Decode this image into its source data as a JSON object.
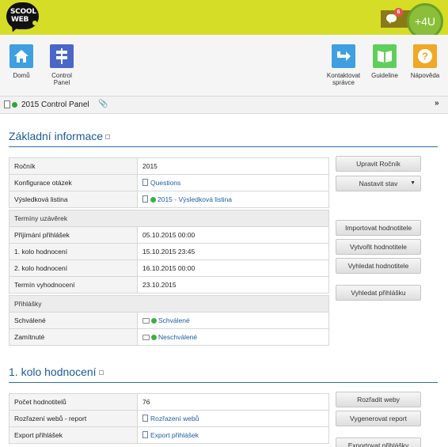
{
  "header": {
    "logo_line1": "SCOOL",
    "logo_line2": "WEB",
    "message_count": "6",
    "plus4u_label": "+4U"
  },
  "toolbar": {
    "items": [
      {
        "label": "Domů",
        "icon": "home-icon"
      },
      {
        "label": "Control Panel",
        "icon": "signpost-icon"
      },
      {
        "label": "Kontaktovat správce",
        "icon": "arrow-right-icon"
      },
      {
        "label": "Guideline",
        "icon": "book-icon"
      },
      {
        "label": "Nápověda",
        "icon": "question-icon"
      }
    ]
  },
  "breadcrumb": {
    "title": "2015 Control Panel"
  },
  "section1": {
    "title": "Základní informace",
    "rows": [
      {
        "key": "Ročník",
        "value": "2015"
      },
      {
        "key": "Konfigurace otázek",
        "value": "Questions"
      },
      {
        "key": "Výsledková listina",
        "value": "2015 - Výsledková listina"
      }
    ],
    "group_deadlines": "Termíny uzávěrek",
    "deadline_rows": [
      {
        "key": "Přijímání přihlášek",
        "value": "05.10.2015 00:00"
      },
      {
        "key": "1. kolo hodnocení",
        "value": "15.10.2015 23:45"
      },
      {
        "key": "2. kolo hodnocení",
        "value": "16.10.2015 00:00"
      },
      {
        "key": "Termín vyhodnocení",
        "value": "23.10.2015"
      }
    ],
    "group_applications": "Přihlášky",
    "application_rows": [
      {
        "key": "Schválené",
        "value": "Schválené"
      },
      {
        "key": "Zamítnuté",
        "value": "Neschválené"
      }
    ],
    "buttons": {
      "edit_year": "Upravit Ročník",
      "set_state": "Nastavit stav",
      "import_evaluators": "Importovat hodnotitele",
      "create_evaluator": "Vytvořit hodnotitele",
      "find_evaluator": "Vyhledat hodnotitele",
      "find_application": "Vyhledat přihlášku"
    }
  },
  "section2": {
    "title": "1. kolo hodnocení",
    "rows": [
      {
        "key": "Počet hodnotitelů",
        "value": "76"
      },
      {
        "key": "Rozřazení webů - report",
        "value": "Rozřazení webů"
      },
      {
        "key": "Export přihlášek",
        "value": "Export přihlášek"
      }
    ],
    "buttons": {
      "assign_webs": "Rozřadit weby",
      "generate_report": "Vygenerovat report",
      "export_applications": "Exportovat přihlášky"
    }
  }
}
